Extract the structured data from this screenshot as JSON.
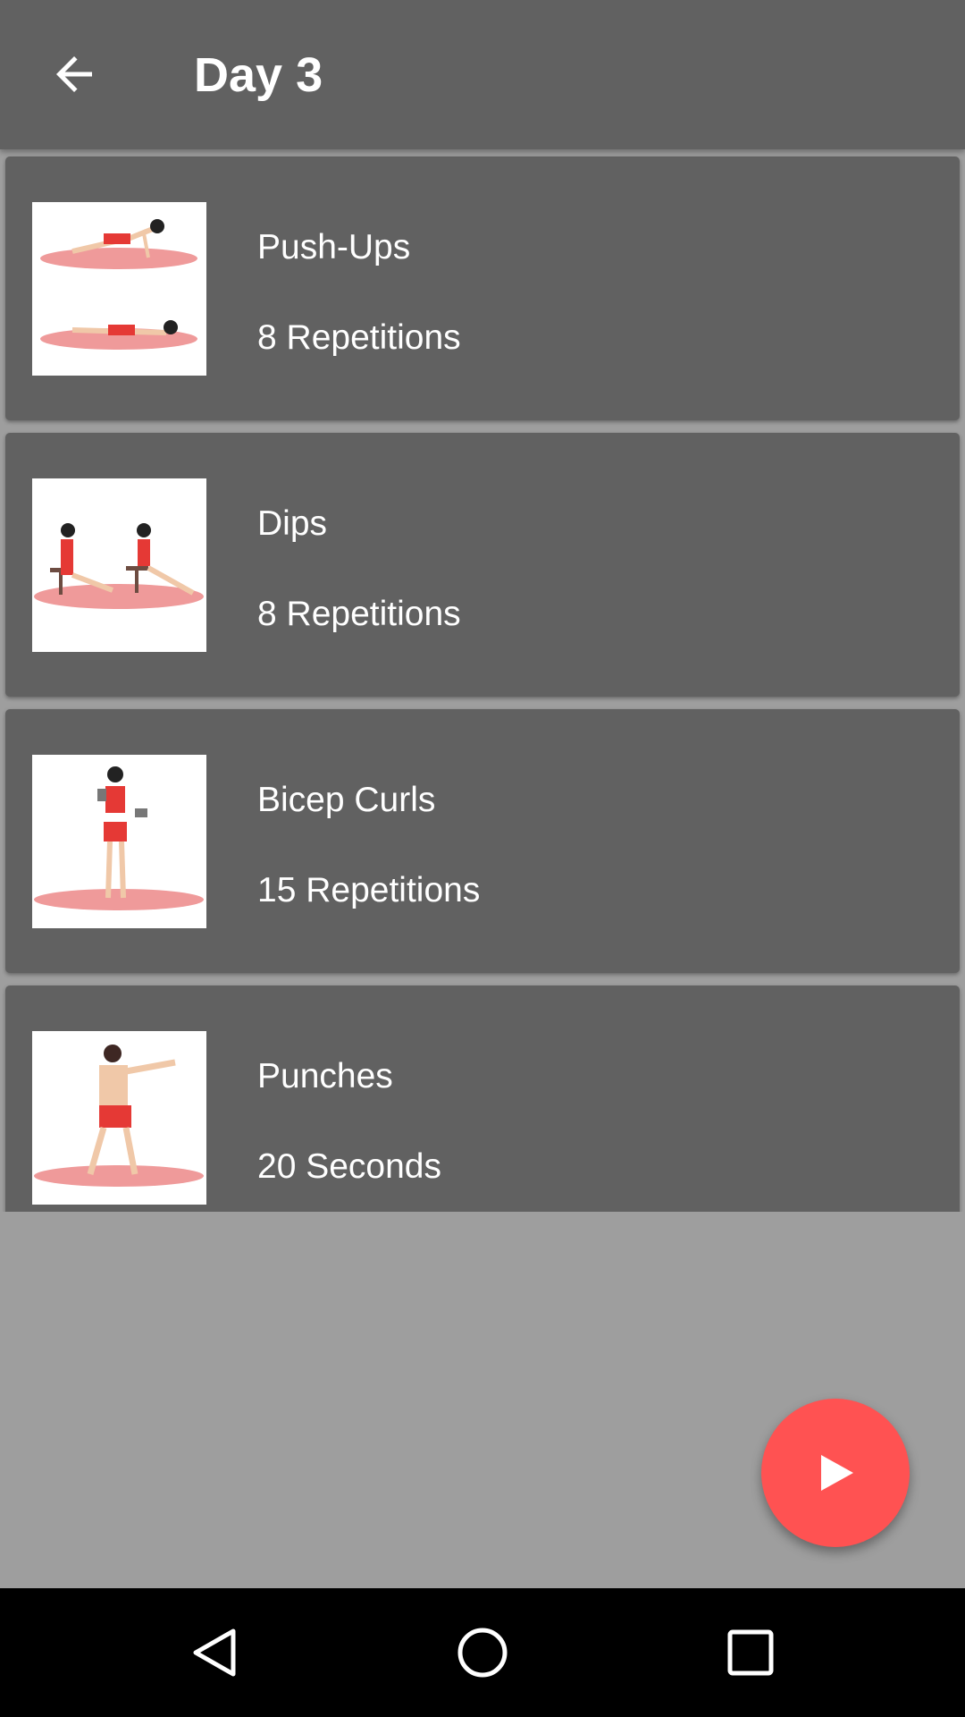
{
  "header": {
    "title": "Day 3",
    "back_icon": "arrow-left-icon"
  },
  "exercises": [
    {
      "name": "Push-Ups",
      "amount": "8 Repetitions",
      "image": "push-ups-illustration"
    },
    {
      "name": "Dips",
      "amount": "8 Repetitions",
      "image": "dips-illustration"
    },
    {
      "name": "Bicep Curls",
      "amount": "15 Repetitions",
      "image": "bicep-curls-illustration"
    },
    {
      "name": "Punches",
      "amount": "20 Seconds",
      "image": "punches-illustration"
    }
  ],
  "fab": {
    "icon": "play-icon",
    "color": "#ff5252"
  },
  "navbar": {
    "icons": [
      "back-triangle-icon",
      "home-circle-icon",
      "recents-square-icon"
    ]
  }
}
